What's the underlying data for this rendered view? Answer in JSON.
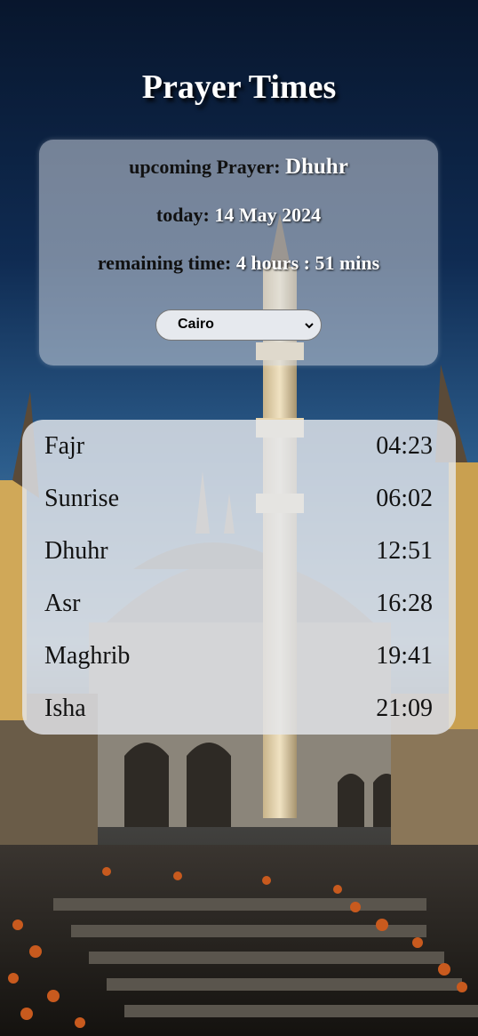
{
  "page_title": "Prayer Times",
  "upcoming": {
    "label": "upcoming Prayer: ",
    "value": "Dhuhr"
  },
  "today": {
    "label": "today: ",
    "value": "14 May 2024"
  },
  "remaining": {
    "label": "remaining time: ",
    "value": "4 hours : 51 mins"
  },
  "city_select": {
    "selected": "Cairo"
  },
  "prayers": [
    {
      "name": "Fajr",
      "time": "04:23"
    },
    {
      "name": "Sunrise",
      "time": "06:02"
    },
    {
      "name": "Dhuhr",
      "time": "12:51"
    },
    {
      "name": "Asr",
      "time": "16:28"
    },
    {
      "name": "Maghrib",
      "time": "19:41"
    },
    {
      "name": "Isha",
      "time": "21:09"
    }
  ]
}
